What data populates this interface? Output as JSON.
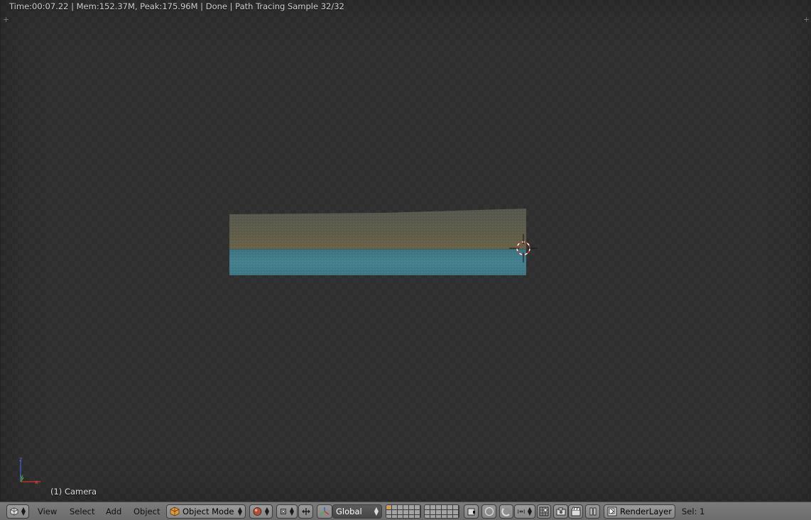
{
  "viewport": {
    "status_line": "Time:00:07.22 | Mem:152.37M, Peak:175.96M | Done | Path Tracing Sample 32/32",
    "object_info": "(1) Camera",
    "axis_labels": {
      "x": "x",
      "y": "y",
      "z": "z"
    }
  },
  "header": {
    "editor_type_icon": "cube-icon",
    "menus": [
      "View",
      "Select",
      "Add",
      "Object"
    ],
    "mode": {
      "label": "Object Mode",
      "icon": "object-mode-cube-icon"
    },
    "shading_icon": "sphere-shading-icon",
    "pivot_icon": "pivot-point-icon",
    "manipulator_icon": "manipulator-icon",
    "orientation": {
      "label": "Global",
      "icon": "transform-orientation-icon"
    },
    "layers_icon": "layers-grid-icon",
    "proportional_icon": "proportional-edit-icon",
    "snap_icon": "magnet-snap-icon",
    "snap_element_icon": "snap-increment-icon",
    "render_icons": [
      "camera-render-icon",
      "clapper-render-icon"
    ],
    "pause_icon": "pause-icon",
    "render_layer": {
      "label": "RenderLayer",
      "icon": "render-layer-icon"
    },
    "selection": "Sel: 1"
  },
  "colors": {
    "upper_band": "#5c5e4c",
    "lower_band": "#3f7b87",
    "cursor_red": "#d43a2c"
  }
}
